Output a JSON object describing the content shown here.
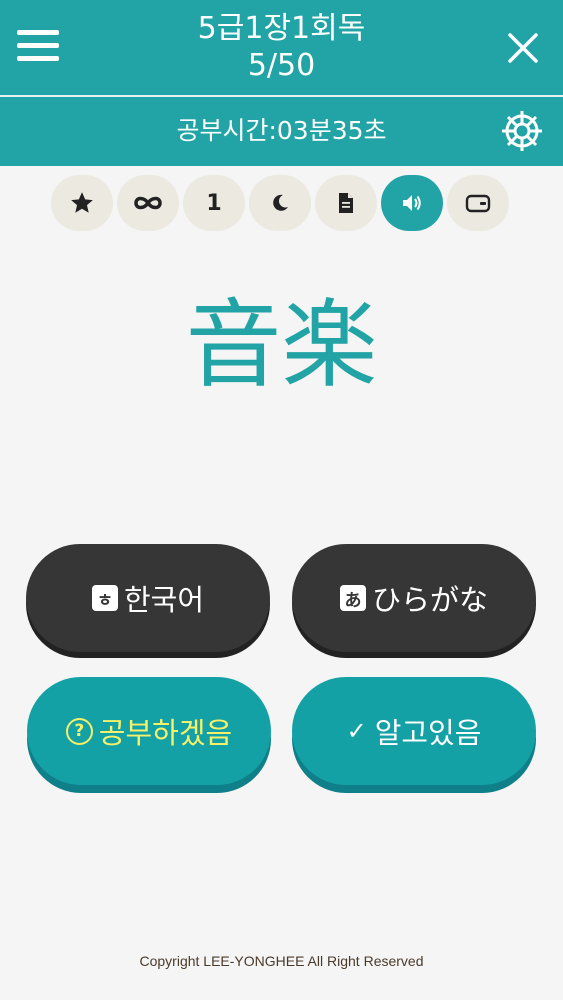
{
  "header": {
    "title": "5급1장1회독",
    "progress": "5/50"
  },
  "subheader": {
    "timer_label": "공부시간:",
    "timer_value": "03분35초"
  },
  "toolbar": {
    "items": [
      {
        "name": "star",
        "icon": "star-icon"
      },
      {
        "name": "infinite",
        "icon": "infinity-icon"
      },
      {
        "name": "count",
        "label": "1"
      },
      {
        "name": "night-mode",
        "icon": "moon-icon"
      },
      {
        "name": "document",
        "icon": "document-icon"
      },
      {
        "name": "sound",
        "icon": "speaker-icon",
        "active": true
      },
      {
        "name": "wallet",
        "icon": "wallet-icon"
      }
    ]
  },
  "card": {
    "kanji": "音楽"
  },
  "buttons": {
    "korean": {
      "badge": "ㅎ",
      "label": "한국어"
    },
    "hiragana": {
      "badge": "あ",
      "label": "ひらがな"
    },
    "study": {
      "label": "공부하겠음"
    },
    "know": {
      "label": "알고있음"
    }
  },
  "footer": {
    "copyright": "Copyright LEE-YONGHEE All Right Reserved"
  },
  "colors": {
    "accent": "#22a4a6",
    "dark_button": "#363636",
    "pill_bg": "#ece9e1",
    "help_text": "#f7f06a"
  }
}
